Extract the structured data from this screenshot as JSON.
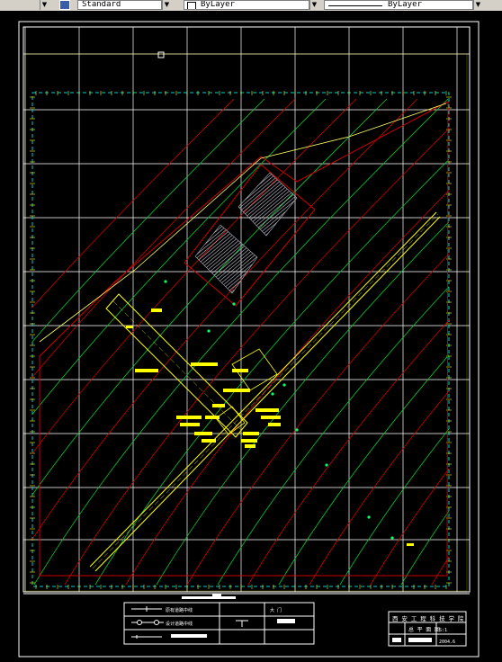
{
  "toolbar": {
    "text_style": "Standard",
    "layer_color": "ByLayer",
    "linetype": "ByLayer"
  },
  "legend": {
    "row1_label": "原有道路中线",
    "row1_right": "大  门",
    "row2_label": "设计道路中线",
    "row3_label": ""
  },
  "title_block": {
    "school": "西 安 工 程 科 技 学 院",
    "drawing_title": "总 平 面 图",
    "meta1": "S:1",
    "meta2": "2004.6"
  },
  "colors": {
    "background": "#000000",
    "frame": "#ffffff",
    "contour_red": "#cc0000",
    "contour_green": "#00cc33",
    "road_yellow": "#ffff00",
    "boundary_cyan": "#00cccc"
  }
}
